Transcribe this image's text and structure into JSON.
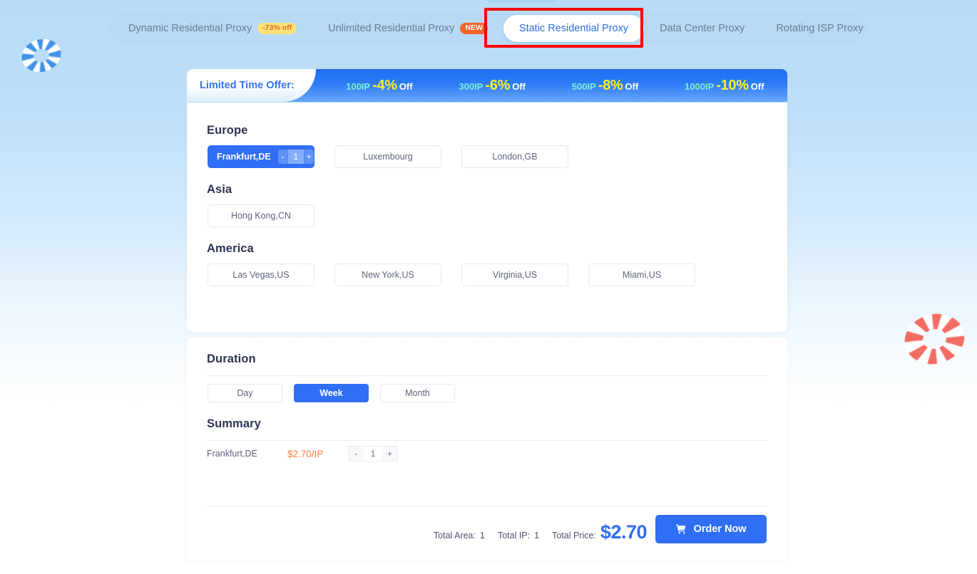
{
  "decor": {
    "ring_blue_name": "life-ring-decoration-blue",
    "ring_red_name": "life-ring-decoration-red"
  },
  "tabs": [
    {
      "label": "Dynamic Residential Proxy",
      "badge": "-73% off",
      "badge_type": "off",
      "active": false
    },
    {
      "label": "Unlimited Residential Proxy",
      "badge": "NEW",
      "badge_type": "new",
      "active": false
    },
    {
      "label": "Static Residential Proxy",
      "badge": "",
      "badge_type": "",
      "active": true
    },
    {
      "label": "Data Center Proxy",
      "badge": "",
      "badge_type": "",
      "active": false
    },
    {
      "label": "Rotating ISP Proxy",
      "badge": "",
      "badge_type": "",
      "active": false
    }
  ],
  "promo": {
    "label": "Limited Time Offer:",
    "tiers": [
      {
        "ip": "100IP",
        "pct": "-4%",
        "off": "Off"
      },
      {
        "ip": "300IP",
        "pct": "-6%",
        "off": "Off"
      },
      {
        "ip": "500IP",
        "pct": "-8%",
        "off": "Off"
      },
      {
        "ip": "1000IP",
        "pct": "-10%",
        "off": "Off"
      }
    ]
  },
  "regions": [
    {
      "title": "Europe",
      "items": [
        {
          "label": "Frankfurt,DE",
          "selected": true,
          "qty": "1",
          "minus": "-",
          "plus": "+"
        },
        {
          "label": "Luxembourg",
          "selected": false
        },
        {
          "label": "London,GB",
          "selected": false
        }
      ]
    },
    {
      "title": "Asia",
      "items": [
        {
          "label": "Hong Kong,CN",
          "selected": false
        }
      ]
    },
    {
      "title": "America",
      "items": [
        {
          "label": "Las Vegas,US",
          "selected": false
        },
        {
          "label": "New York,US",
          "selected": false
        },
        {
          "label": "Virginia,US",
          "selected": false
        },
        {
          "label": "Miami,US",
          "selected": false
        }
      ]
    }
  ],
  "duration": {
    "title": "Duration",
    "options": [
      {
        "label": "Day",
        "active": false
      },
      {
        "label": "Week",
        "active": true
      },
      {
        "label": "Month",
        "active": false
      }
    ]
  },
  "summary": {
    "title": "Summary",
    "rows": [
      {
        "name": "Frankfurt,DE",
        "price": "$2.70/IP",
        "minus": "-",
        "qty": "1",
        "plus": "+"
      }
    ]
  },
  "totals": {
    "area_label": "Total Area:",
    "area_value": "1",
    "ip_label": "Total IP:",
    "ip_value": "1",
    "price_label": "Total Price:",
    "price_value": "$2.70",
    "order_button": "Order Now",
    "cart_icon": "shopping-cart-icon"
  },
  "colors": {
    "accent_blue": "#2f6ef5",
    "promo_yellow": "#ffef25",
    "promo_mint": "#7bf0d8",
    "price_orange": "#f97b3d",
    "badge_new": "#f4622d",
    "badge_off": "#ffe175",
    "annotation_red": "#ff0000",
    "page_bg_top": "#b8dcf7",
    "page_bg_bottom": "#ffffff"
  }
}
